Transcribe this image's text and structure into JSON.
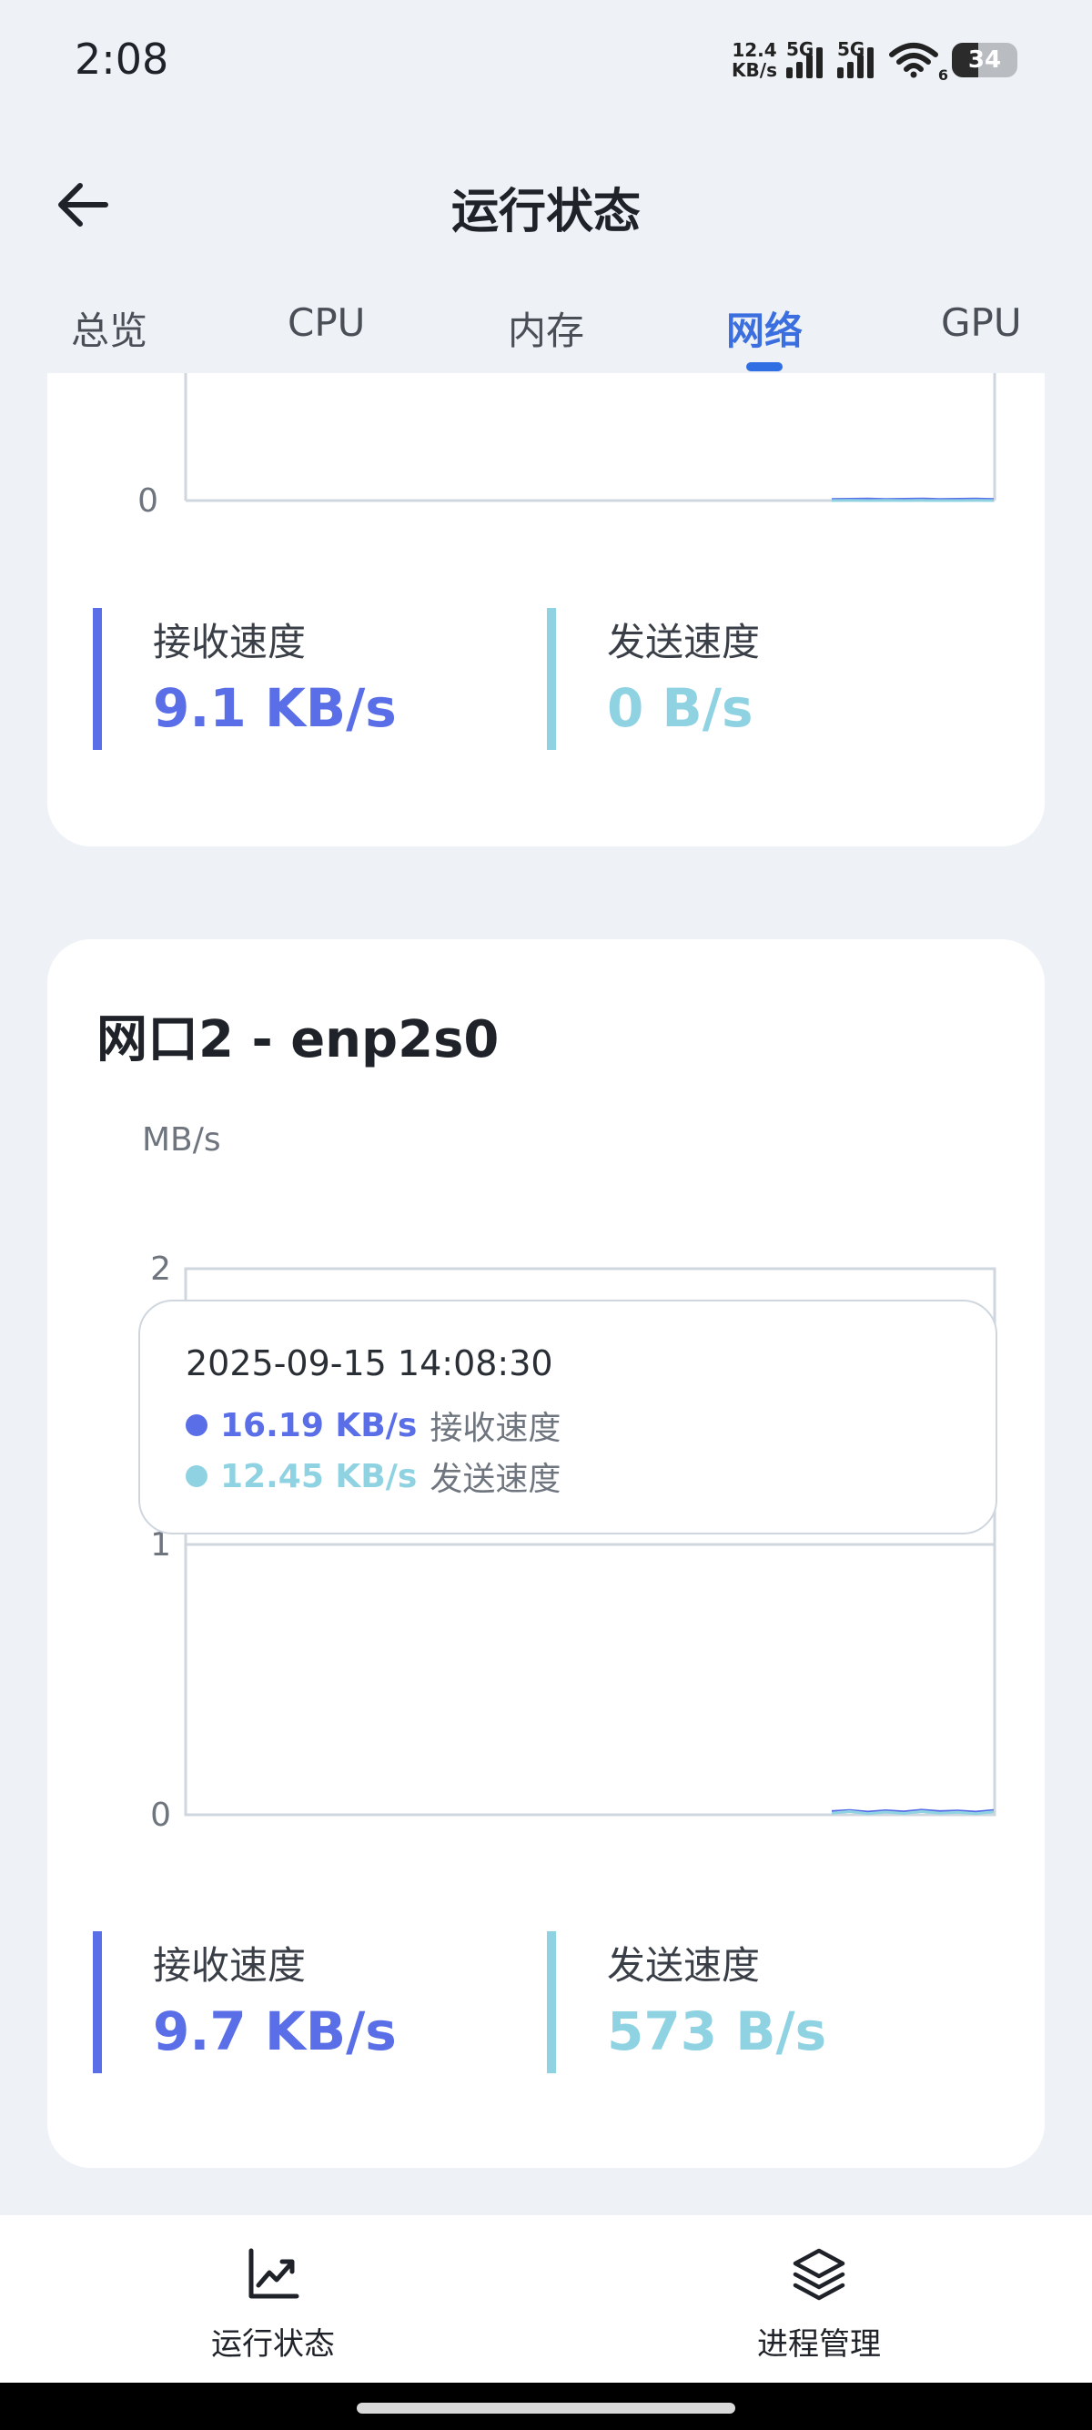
{
  "status_bar": {
    "time": "2:08",
    "net_speed_value": "12.4",
    "net_speed_unit": "KB/s",
    "sim1_label": "5G",
    "sim2_label": "5G",
    "wifi_label": "6",
    "battery_level": "34"
  },
  "header": {
    "title": "运行状态"
  },
  "tabs": [
    {
      "label": "总览",
      "active": false
    },
    {
      "label": "CPU",
      "active": false
    },
    {
      "label": "内存",
      "active": false
    },
    {
      "label": "网络",
      "active": true
    },
    {
      "label": "GPU",
      "active": false
    }
  ],
  "interface_1": {
    "y_tick_zero": "0",
    "receive": {
      "label": "接收速度",
      "value": "9.1 KB/s"
    },
    "send": {
      "label": "发送速度",
      "value": "0 B/s"
    }
  },
  "interface_2": {
    "title": "网口2 - enp2s0",
    "unit": "MB/s",
    "y_ticks": [
      "2",
      "1",
      "0"
    ],
    "tooltip": {
      "time": "2025-09-15 14:08:30",
      "receive_value": "16.19 KB/s",
      "receive_label": "接收速度",
      "send_value": "12.45 KB/s",
      "send_label": "发送速度"
    },
    "receive": {
      "label": "接收速度",
      "value": "9.7 KB/s"
    },
    "send": {
      "label": "发送速度",
      "value": "573 B/s"
    }
  },
  "chart_data": [
    {
      "type": "line",
      "ylabel": "",
      "ylim": [
        0,
        null
      ],
      "series": [
        {
          "name": "接收速度",
          "color": "#5a6ee8",
          "values": [
            0.009,
            0.01,
            0.011,
            0.009,
            0.01,
            0.012,
            0.009,
            0.01,
            0.011,
            0.009
          ]
        },
        {
          "name": "发送速度",
          "color": "#8fd3e3",
          "values": [
            0,
            0.001,
            0,
            0.002,
            0,
            0.001,
            0,
            0,
            0.001,
            0
          ]
        }
      ]
    },
    {
      "type": "line",
      "ylabel": "MB/s",
      "ylim": [
        0,
        2
      ],
      "series": [
        {
          "name": "接收速度",
          "color": "#5a6ee8",
          "values": [
            0.012,
            0.016,
            0.01,
            0.015,
            0.011,
            0.017,
            0.012,
            0.014,
            0.01,
            0.016
          ]
        },
        {
          "name": "发送速度",
          "color": "#8fd3e3",
          "values": [
            0.006,
            0.012,
            0.004,
            0.01,
            0.005,
            0.012,
            0.006,
            0.009,
            0.004,
            0.011
          ]
        }
      ]
    }
  ],
  "colors": {
    "accent": "#3b6fe0",
    "receive": "#5a6ee8",
    "send": "#8fd3e3",
    "background": "#eef2f7"
  },
  "bottom_nav": [
    {
      "label": "运行状态",
      "icon": "line-chart-icon",
      "active": true
    },
    {
      "label": "进程管理",
      "icon": "layers-icon",
      "active": false
    }
  ]
}
